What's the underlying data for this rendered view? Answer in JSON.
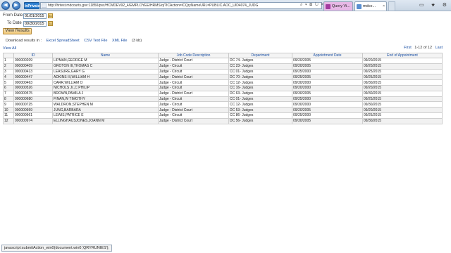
{
  "browser": {
    "back_glyph": "◀",
    "forward_glyph": "▶",
    "inprivate_label": "InPrivate",
    "url": "http://hrtest.mdcourts.gov:11850/psc/HCMDEV92_4/EMPLOYEE/HRMS/q/?ICAction=ICQryNameURL=PUBLIC.AOC_UID4074_JUDG",
    "addr_icons": "⌕ ▾ ⊠ ↻ ×",
    "tabs": [
      {
        "label": "Query Vi..."
      },
      {
        "label": "mdco..."
      }
    ],
    "tab_close": "×",
    "window_buttons": "▭ ★ ⚙"
  },
  "form": {
    "from_label": "From Date",
    "from_value": "01/01/2015",
    "to_label": "To Date",
    "to_value": "09/30/2015",
    "cal_glyph": "31",
    "view_button": "View Results"
  },
  "download": {
    "label": "Download results in :",
    "excel": "Excel SpreadSheet",
    "csv": "CSV Text File",
    "xml": "XML File",
    "size": "(3 kb)"
  },
  "view_all": "View All",
  "pager": {
    "first": "First",
    "count": "1-12 of 12",
    "last": "Last"
  },
  "table": {
    "headers": [
      "",
      "ID",
      "Name",
      "Job Code Description",
      "Department",
      "Appointment Date",
      "End of Appointment"
    ],
    "rows": [
      [
        "1",
        "000000209",
        "LIPMAN,GEORGE M",
        "Judge - District Court",
        "DC 74- Judges",
        "09/20/2005",
        "09/20/2015"
      ],
      [
        "2",
        "000000409",
        "GROTON III,THOMAS C",
        "Judge - Circuit",
        "CC 23- Judges",
        "09/20/2005",
        "09/20/2015"
      ],
      [
        "3",
        "000000413",
        "LEASURE,GARY G",
        "Judge - Circuit",
        "CC 01- Judges",
        "09/25/2000",
        "09/25/2015"
      ],
      [
        "4",
        "000000447",
        "ADKINS III,WILLIAM H",
        "Judge - District Court",
        "DC 70- Judges",
        "09/25/2005",
        "09/25/2015"
      ],
      [
        "5",
        "000000463",
        "CARR,WILLIAM O",
        "Judge - Circuit",
        "CC 12- Judges",
        "09/30/2000",
        "09/30/2015"
      ],
      [
        "6",
        "000000526",
        "NICHOLS Jr.,C PHILIP",
        "Judge - Circuit",
        "CC 16- Judges",
        "09/20/2000",
        "09/20/2015"
      ],
      [
        "7",
        "000000575",
        "BROWN,PAMILA J",
        "Judge - District Court",
        "DC 63- Judges",
        "09/30/2005",
        "09/30/2015"
      ],
      [
        "8",
        "000000680",
        "FINAN,W TIMOTHY",
        "Judge - Circuit",
        "CC 01- Judges",
        "09/25/2000",
        "09/25/2015"
      ],
      [
        "9",
        "000000725",
        "WALDRON,STEPHEN M",
        "Judge - Circuit",
        "CC 12- Judges",
        "09/30/2000",
        "09/30/2015"
      ],
      [
        "10",
        "000000959",
        "JUNG,BARBARA",
        "Judge - District Court",
        "DC 53- Judges",
        "09/20/2005",
        "09/20/2015"
      ],
      [
        "11",
        "000000961",
        "LEWIS,PATRICE E",
        "Judge - Circuit",
        "CC 86- Judges",
        "09/25/2000",
        "09/25/2015"
      ],
      [
        "12",
        "000000974",
        "ELLINGHAUSJONES,JOANN M",
        "Judge - District Court",
        "DC 56- Judges",
        "09/30/2005",
        "09/30/2015"
      ]
    ]
  },
  "status_bar": "javascript:submitAction_win0(document.win0,'QRYRUNIES');"
}
